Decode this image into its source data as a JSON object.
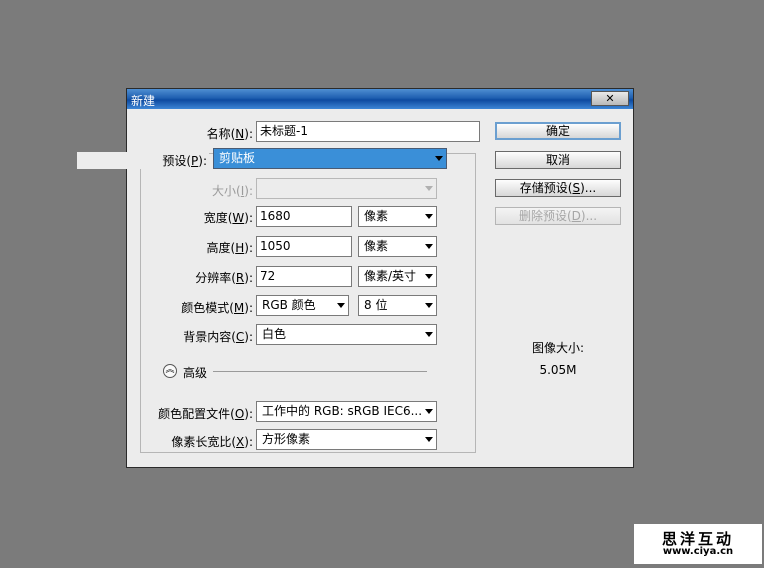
{
  "dialog": {
    "title": "新建",
    "close_icon": "close-icon",
    "name": {
      "label_pre": "名称(",
      "key": "N",
      "label_post": "):",
      "value": "未标题-1"
    },
    "preset": {
      "label_pre": "预设(",
      "key": "P",
      "label_post": "):",
      "value": "剪贴板"
    },
    "size": {
      "label_pre": "大小(",
      "key": "I",
      "label_post": "):",
      "value": ""
    },
    "width": {
      "label_pre": "宽度(",
      "key": "W",
      "label_post": "):",
      "value": "1680",
      "unit": "像素"
    },
    "height": {
      "label_pre": "高度(",
      "key": "H",
      "label_post": "):",
      "value": "1050",
      "unit": "像素"
    },
    "resolution": {
      "label_pre": "分辨率(",
      "key": "R",
      "label_post": "):",
      "value": "72",
      "unit": "像素/英寸"
    },
    "color_mode": {
      "label_pre": "颜色模式(",
      "key": "M",
      "label_post": "):",
      "value": "RGB 颜色",
      "depth": "8 位"
    },
    "background": {
      "label_pre": "背景内容(",
      "key": "C",
      "label_post": "):",
      "value": "白色"
    },
    "advanced": {
      "label": "高级",
      "icon": "chevron-up-icon"
    },
    "color_profile": {
      "label_pre": "颜色配置文件(",
      "key": "O",
      "label_post": "):",
      "value": "工作中的 RGB: sRGB IEC6..."
    },
    "pixel_aspect": {
      "label_pre": "像素长宽比(",
      "key": "X",
      "label_post": "):",
      "value": "方形像素"
    },
    "buttons": {
      "ok": "确定",
      "cancel": "取消",
      "save_preset": {
        "pre": "存储预设(",
        "key": "S",
        "post": ")..."
      },
      "delete_preset": {
        "pre": "删除预设(",
        "key": "D",
        "post": ")..."
      }
    },
    "image_size": {
      "label": "图像大小:",
      "value": "5.05M"
    }
  },
  "watermark": {
    "line1": "思洋互动",
    "line2": "www.ciya.cn"
  },
  "colors": {
    "background": "#7b7b7b",
    "dialog": "#ececec",
    "titlebar": "#1f5fb0",
    "selection": "#3a8fd8"
  }
}
